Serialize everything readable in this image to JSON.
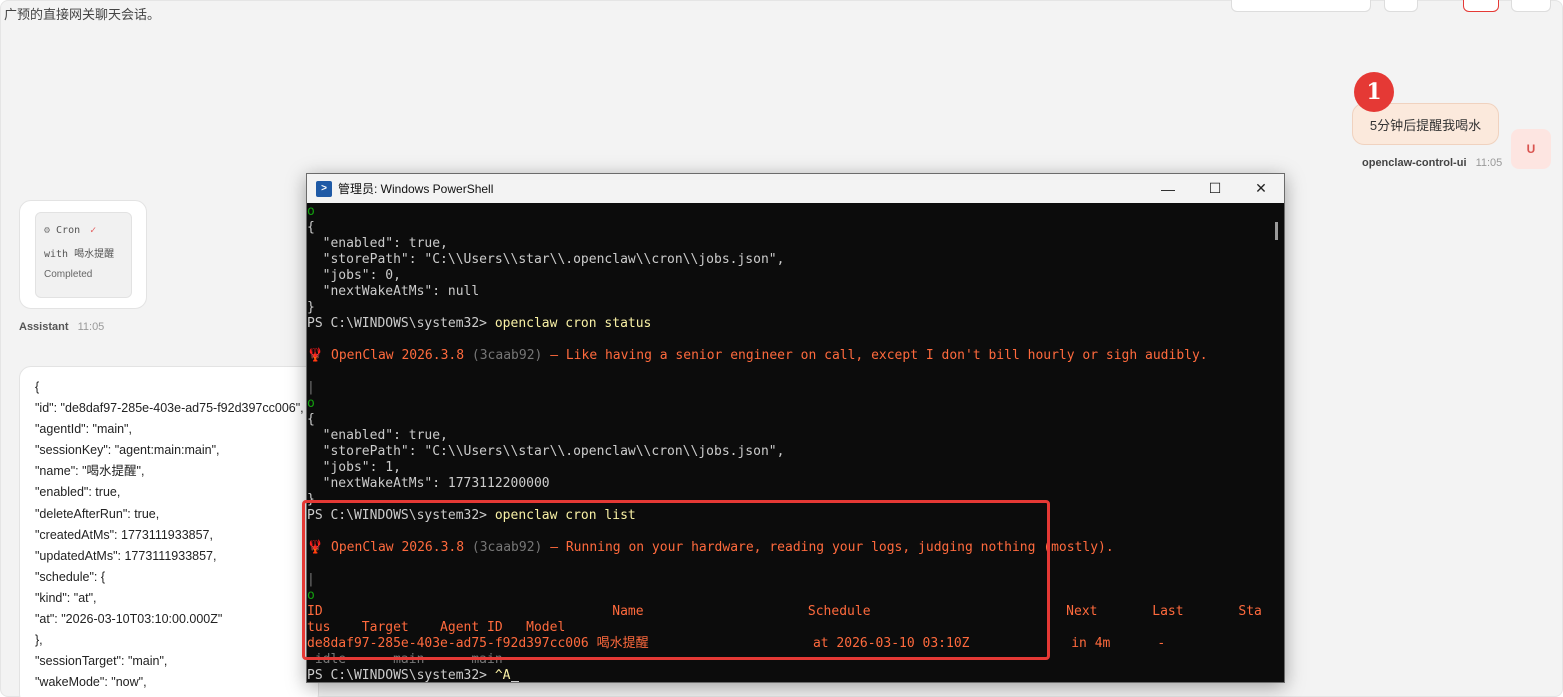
{
  "header": {
    "subtitle": "广预的直接网关聊天会话。"
  },
  "user_message": {
    "step_number": "1",
    "text": "5分钟后提醒我喝水",
    "avatar_initial": "U",
    "sender": "openclaw-control-ui",
    "time": "11:05"
  },
  "tool_card": {
    "tool_name": "Cron",
    "detail": "with 喝水提醒",
    "status": "Completed"
  },
  "assistant": {
    "sender": "Assistant",
    "time": "11:05"
  },
  "json_lines": [
    "{",
    "\"id\": \"de8daf97-285e-403e-ad75-f92d397cc006\",",
    "\"agentId\": \"main\",",
    "\"sessionKey\": \"agent:main:main\",",
    "\"name\": \"喝水提醒\",",
    "\"enabled\": true,",
    "\"deleteAfterRun\": true,",
    "\"createdAtMs\": 1773111933857,",
    "\"updatedAtMs\": 1773111933857,",
    "\"schedule\": {",
    "\"kind\": \"at\",",
    "\"at\": \"2026-03-10T03:10:00.000Z\"",
    "},",
    "\"sessionTarget\": \"main\",",
    "\"wakeMode\": \"now\","
  ],
  "powershell": {
    "title": "管理员: Windows PowerShell",
    "icon_label": ">",
    "minimize_label": "—",
    "maximize_label": "☐",
    "close_label": "✕",
    "lines": [
      {
        "text": "o",
        "color": "green"
      },
      {
        "text": "{",
        "color": "default"
      },
      {
        "text": "  \"enabled\": true,",
        "color": "default"
      },
      {
        "text": "  \"storePath\": \"C:\\\\Users\\\\star\\\\.openclaw\\\\cron\\\\jobs.json\",",
        "color": "default"
      },
      {
        "text": "  \"jobs\": 0,",
        "color": "default"
      },
      {
        "text": "  \"nextWakeAtMs\": null",
        "color": "default"
      },
      {
        "text": "}",
        "color": "default"
      },
      {
        "text": "PS C:\\WINDOWS\\system32> openclaw cron status",
        "color": "prompt"
      },
      {
        "text": "",
        "color": "default"
      },
      {
        "text": "🦞 OpenClaw 2026.3.8 (3caab92) — Like having a senior engineer on call, except I don't bill hourly or sigh audibly.",
        "color": "banner"
      },
      {
        "text": "",
        "color": "default"
      },
      {
        "text": "|",
        "color": "grey"
      },
      {
        "text": "o",
        "color": "green"
      },
      {
        "text": "{",
        "color": "default"
      },
      {
        "text": "  \"enabled\": true,",
        "color": "default"
      },
      {
        "text": "  \"storePath\": \"C:\\\\Users\\\\star\\\\.openclaw\\\\cron\\\\jobs.json\",",
        "color": "default"
      },
      {
        "text": "  \"jobs\": 1,",
        "color": "default"
      },
      {
        "text": "  \"nextWakeAtMs\": 1773112200000",
        "color": "default"
      },
      {
        "text": "}",
        "color": "default"
      },
      {
        "text": "PS C:\\WINDOWS\\system32> openclaw cron list",
        "color": "prompt"
      },
      {
        "text": "",
        "color": "default"
      },
      {
        "text": "🦞 OpenClaw 2026.3.8 (3caab92) — Running on your hardware, reading your logs, judging nothing (mostly).",
        "color": "banner2"
      },
      {
        "text": "",
        "color": "default"
      },
      {
        "text": "|",
        "color": "grey"
      },
      {
        "text": "o",
        "color": "green"
      },
      {
        "text": "ID                                     Name                     Schedule                         Next       Last       Sta",
        "color": "header"
      },
      {
        "text": "tus    Target    Agent ID   Model",
        "color": "header"
      },
      {
        "text": "de8daf97-285e-403e-ad75-f92d397cc006 喝水提醒                     at 2026-03-10 03:10Z             in 4m      -",
        "color": "row"
      },
      {
        "text": " idle      main      main",
        "color": "row-faded"
      },
      {
        "text": "PS C:\\WINDOWS\\system32> ^A",
        "color": "prompt-end"
      }
    ]
  },
  "colors": {
    "accent_red": "#e53935",
    "terminal_bg": "#0c0c0c",
    "terminal_fg": "#cccccc",
    "banner_orange": "#ff6a3d",
    "prompt_yellow": "#f9f1a5",
    "user_bubble_bg": "#fbe9dc"
  }
}
